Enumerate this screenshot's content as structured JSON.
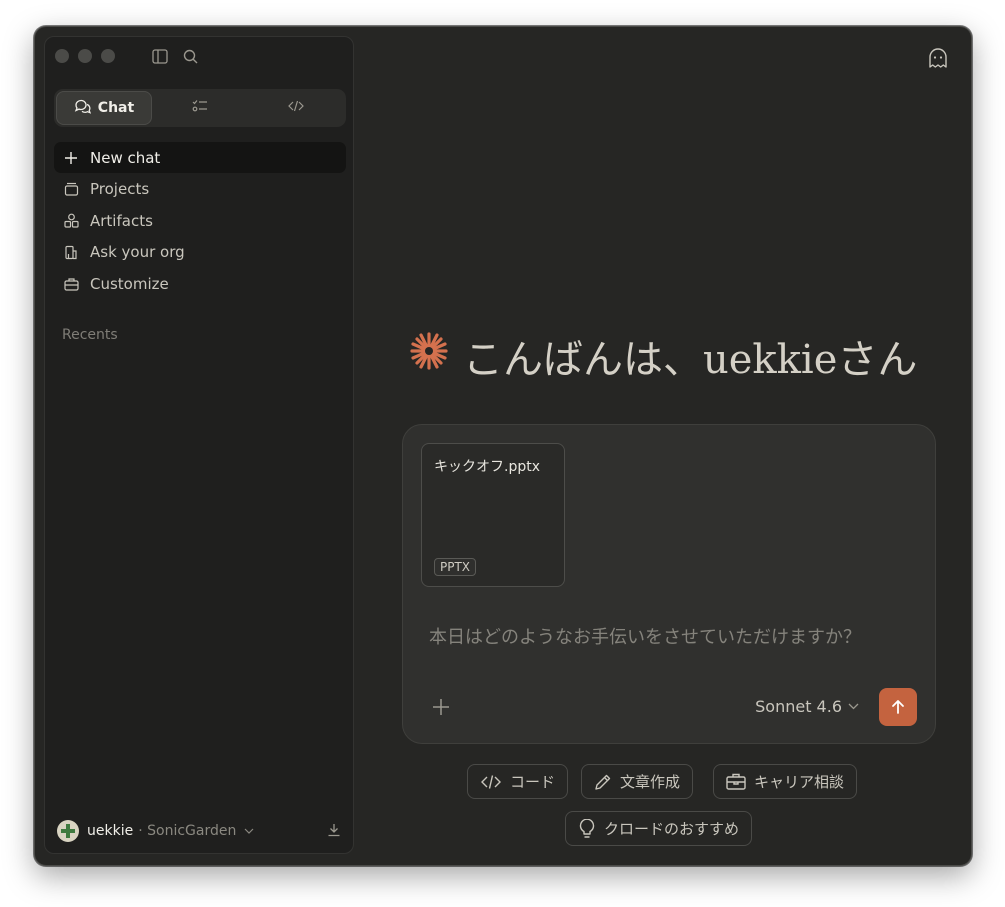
{
  "sidebar": {
    "tabs": [
      {
        "label": "Chat",
        "icon": "chat-bubbles-icon"
      },
      {
        "label": "",
        "icon": "tasks-icon"
      },
      {
        "label": "",
        "icon": "code-icon"
      }
    ],
    "nav": [
      {
        "label": "New chat",
        "icon": "plus-icon"
      },
      {
        "label": "Projects",
        "icon": "folder-icon"
      },
      {
        "label": "Artifacts",
        "icon": "shapes-icon"
      },
      {
        "label": "Ask your org",
        "icon": "building-icon"
      },
      {
        "label": "Customize",
        "icon": "briefcase-icon"
      }
    ],
    "recents_label": "Recents",
    "account": {
      "name": "uekkie",
      "org": "· SonicGarden"
    }
  },
  "main": {
    "greeting": "こんばんは、uekkieさん",
    "attachment": {
      "name": "キックオフ.pptx",
      "type": "PPTX"
    },
    "prompt_placeholder": "本日はどのようなお手伝いをさせていただけますか？",
    "model": "Sonnet 4.6",
    "chips": [
      {
        "label": "コード",
        "icon": "code-icon"
      },
      {
        "label": "文章作成",
        "icon": "pencil-icon"
      },
      {
        "label": "キャリア相談",
        "icon": "briefcase-icon"
      },
      {
        "label": "クロードのおすすめ",
        "icon": "lightbulb-icon"
      }
    ]
  },
  "colors": {
    "accent": "#c4633f",
    "background": "#262624",
    "sidebar": "#1f1f1e"
  }
}
